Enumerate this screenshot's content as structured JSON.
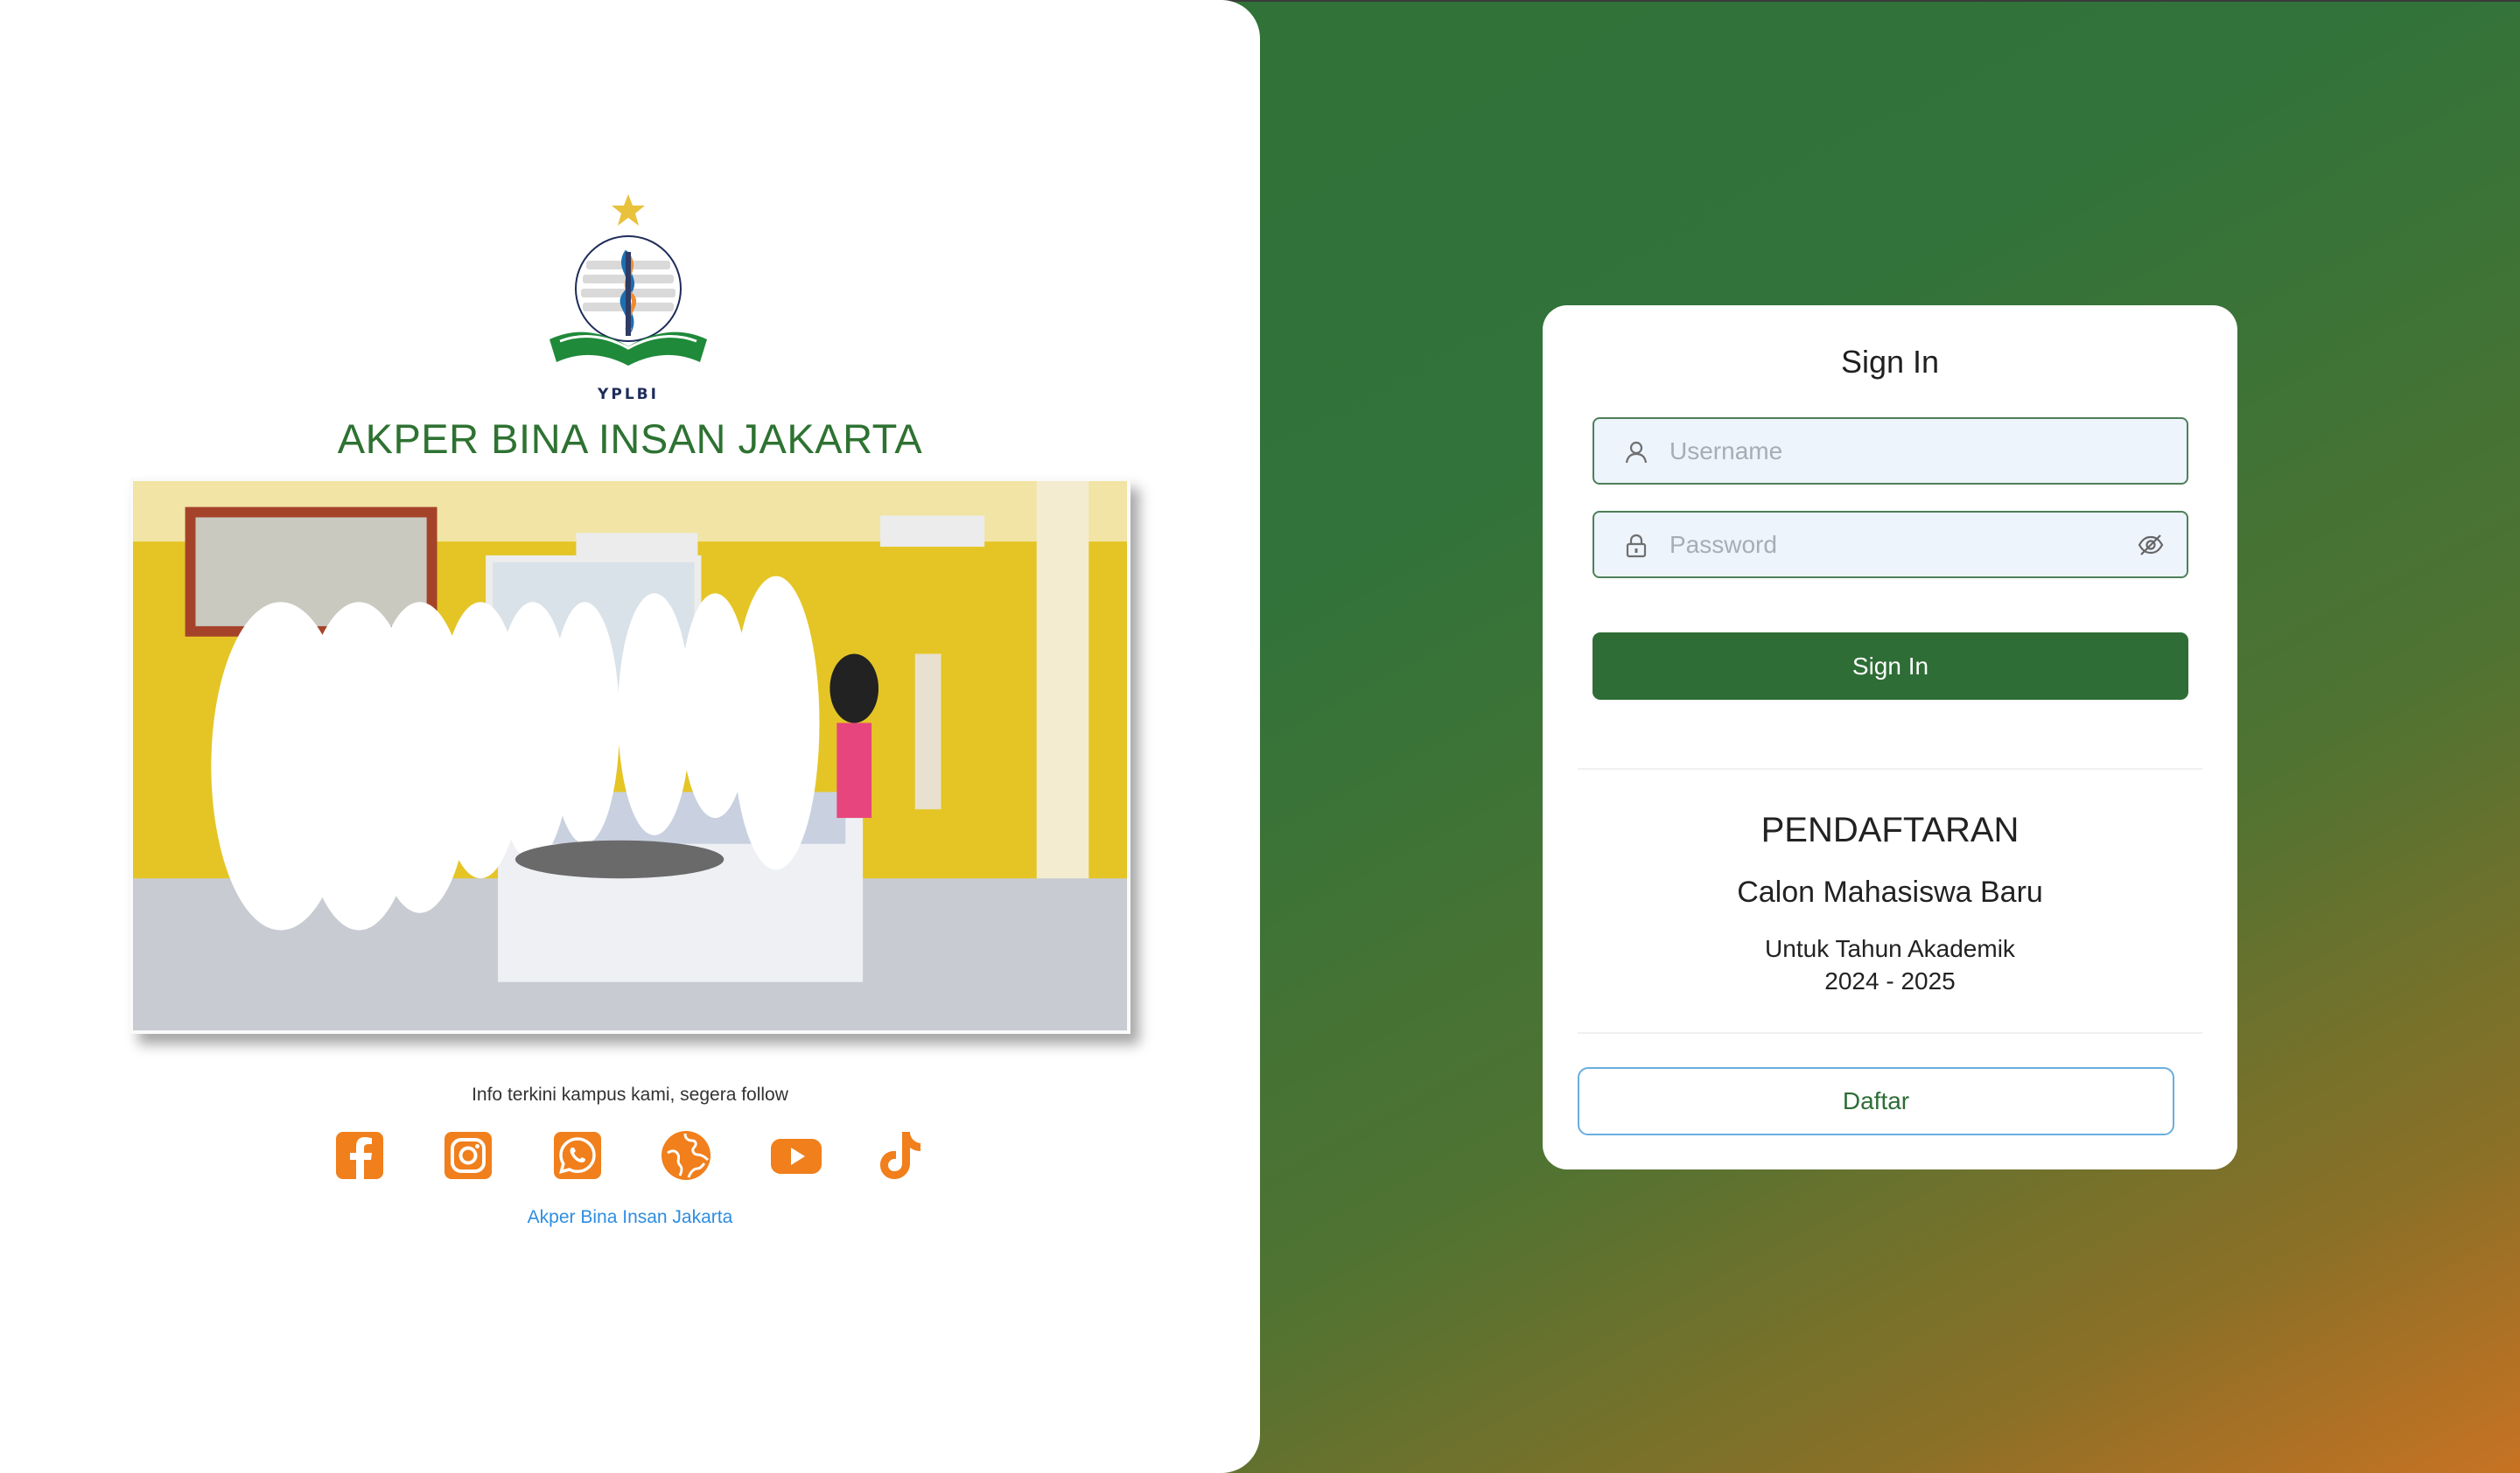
{
  "left": {
    "logo": {
      "ring_text": "AKPER BINA INSAN JAKARTA",
      "bottom_text": "YPLBI"
    },
    "title": "AKPER BINA INSAN JAKARTA",
    "follow_text": "Info terkini kampus kami, segera follow",
    "social": [
      {
        "name": "facebook-icon"
      },
      {
        "name": "instagram-icon"
      },
      {
        "name": "whatsapp-icon"
      },
      {
        "name": "globe-icon"
      },
      {
        "name": "youtube-icon"
      },
      {
        "name": "tiktok-icon"
      }
    ],
    "site_link": "Akper Bina Insan Jakarta"
  },
  "login": {
    "title": "Sign In",
    "username_placeholder": "Username",
    "password_placeholder": "Password",
    "signin_label": "Sign In"
  },
  "registration": {
    "title": "PENDAFTARAN",
    "subtitle": "Calon Mahasiswa Baru",
    "year_label": "Untuk Tahun Akademik",
    "year": "2024 - 2025",
    "button_label": "Daftar"
  },
  "colors": {
    "brand_green": "#2e6d36",
    "social_orange": "#f07f1c",
    "link_blue": "#2e8de0"
  }
}
